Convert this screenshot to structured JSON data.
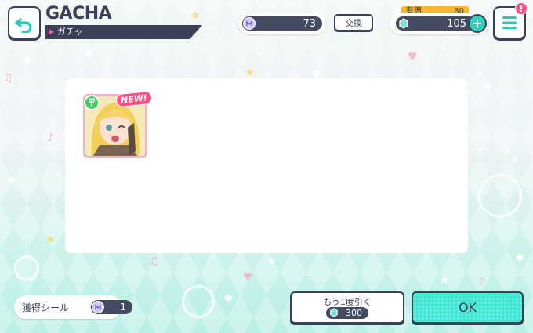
{
  "header": {
    "title": "GACHA",
    "subtitle": "ガチャ"
  },
  "currency": {
    "seal_count": "73",
    "exchange_label": "交換",
    "paid_label": "有償",
    "paid_value": "80",
    "gem_count": "105"
  },
  "menu": {
    "alert_badge": "!"
  },
  "result": {
    "cards": [
      {
        "new_label": "NEW!",
        "attribute": "pure"
      }
    ]
  },
  "footer": {
    "seal_label": "獲得シール",
    "seal_value": "1",
    "pull_again_label": "もう1度引く",
    "pull_again_cost": "300",
    "ok_label": "OK"
  },
  "colors": {
    "accent_mint": "#3fe8d3",
    "navy": "#3b3f57",
    "badge_pink": "#ff4f84",
    "paid_gold": "#f5b829"
  }
}
